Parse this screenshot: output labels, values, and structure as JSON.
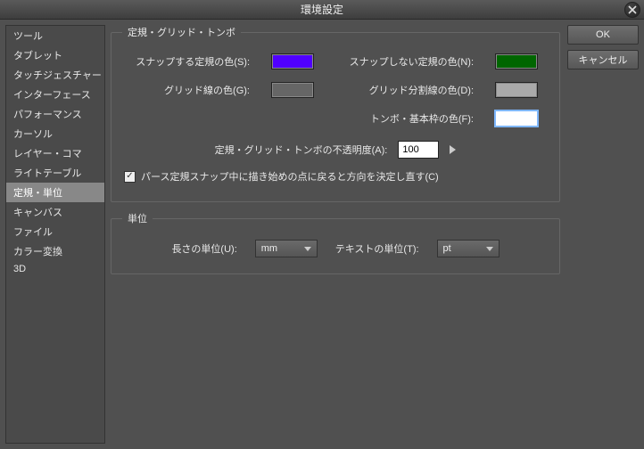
{
  "window": {
    "title": "環境設定"
  },
  "buttons": {
    "ok": "OK",
    "cancel": "キャンセル"
  },
  "sidebar": {
    "items": [
      {
        "label": "ツール"
      },
      {
        "label": "タブレット"
      },
      {
        "label": "タッチジェスチャー"
      },
      {
        "label": "インターフェース"
      },
      {
        "label": "パフォーマンス"
      },
      {
        "label": "カーソル"
      },
      {
        "label": "レイヤー・コマ"
      },
      {
        "label": "ライトテーブル"
      },
      {
        "label": "定規・単位"
      },
      {
        "label": "キャンバス"
      },
      {
        "label": "ファイル"
      },
      {
        "label": "カラー変換"
      },
      {
        "label": "3D"
      }
    ],
    "selected_index": 8
  },
  "group_ruler": {
    "legend": "定規・グリッド・トンボ",
    "snap_color_label": "スナップする定規の色(S):",
    "snap_color": "#5000ff",
    "nosnap_color_label": "スナップしない定規の色(N):",
    "nosnap_color": "#006600",
    "grid_color_label": "グリッド線の色(G):",
    "grid_color": "#666666",
    "grid_div_color_label": "グリッド分割線の色(D):",
    "grid_div_color": "#aaaaaa",
    "crop_color_label": "トンボ・基本枠の色(F):",
    "crop_color": "#ffffff",
    "opacity_label": "定規・グリッド・トンボの不透明度(A):",
    "opacity_value": "100",
    "pers_check_label": "パース定規スナップ中に描き始めの点に戻ると方向を決定し直す(C)",
    "pers_checked": true
  },
  "group_units": {
    "legend": "単位",
    "length_label": "長さの単位(U):",
    "length_value": "mm",
    "text_label": "テキストの単位(T):",
    "text_value": "pt"
  }
}
